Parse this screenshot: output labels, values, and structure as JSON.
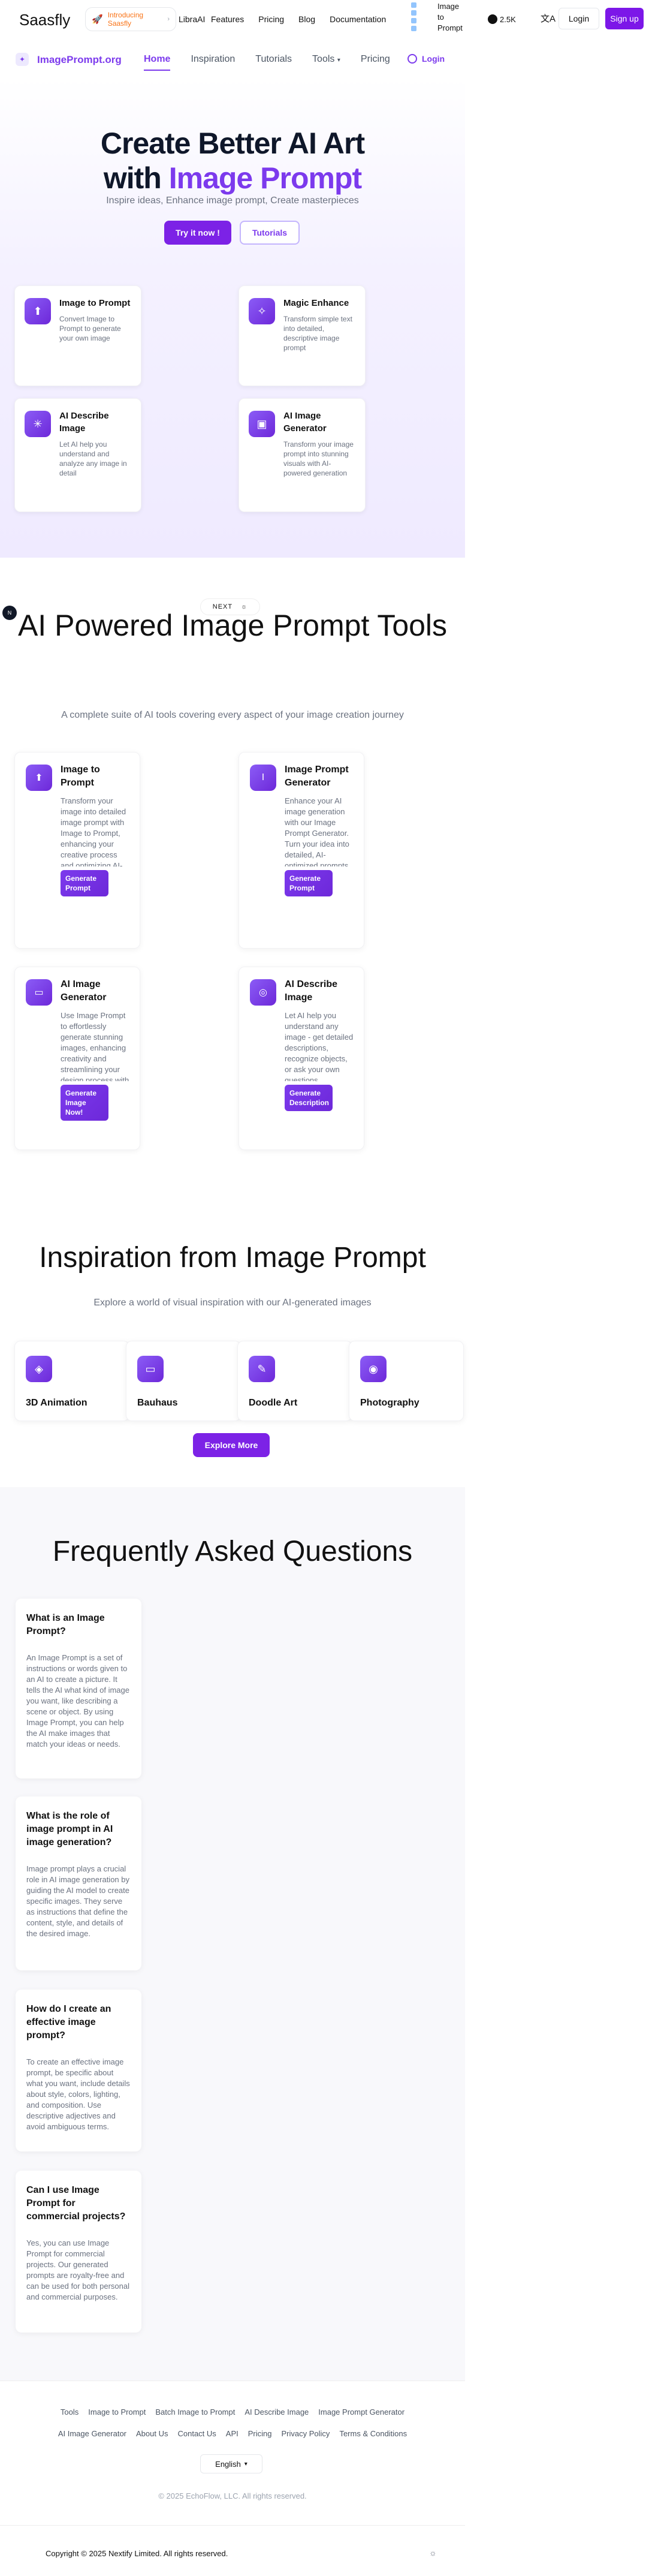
{
  "header": {
    "brand": "Saasfly",
    "intro_pill": "Introducing Saasfly",
    "libra_line1": "Libra",
    "libra_line2": "AI",
    "nav": [
      "Features",
      "Pricing",
      "Blog",
      "Documentation"
    ],
    "image_to_prompt": "Image to Prompt",
    "github_stars": "2.5K",
    "login": "Login",
    "signup": "Sign up"
  },
  "subnav": {
    "brand": "ImagePrompt.org",
    "links": [
      "Home",
      "Inspiration",
      "Tutorials",
      "Tools",
      "Pricing"
    ],
    "active": "Home",
    "login": "Login"
  },
  "hero": {
    "title_line1": "Create Better AI Art",
    "title_line2_prefix": "with",
    "title_line2_highlight": "Image Prompt",
    "subtitle": "Inspire ideas, Enhance image prompt, Create masterpieces",
    "try_button": "Try it now !",
    "tutorials_button": "Tutorials",
    "cards": [
      {
        "title": "Image to Prompt",
        "desc": "Convert Image to Prompt to generate your own image",
        "icon": "image-upload-icon"
      },
      {
        "title": "Magic Enhance",
        "desc": "Transform simple text into detailed, descriptive image prompt",
        "icon": "sparkle-icon"
      },
      {
        "title": "AI Describe Image",
        "desc": "Let AI help you understand and analyze any image in detail",
        "icon": "describe-icon"
      },
      {
        "title": "AI Image Generator",
        "desc": "Transform your image prompt into stunning visuals with AI-powered generation",
        "icon": "image-generate-icon"
      }
    ]
  },
  "side_marker": "N",
  "tools": {
    "new_label": "NEXT",
    "title": "AI Powered Image Prompt Tools",
    "subtitle": "A complete suite of AI tools covering every aspect of your image creation journey",
    "cards": [
      {
        "title": "Image to Prompt",
        "desc": "Transform your image into detailed image prompt with Image to Prompt, enhancing your creative process and optimizing AI-driven design efficiency.",
        "button": "Generate Prompt"
      },
      {
        "title": "Image Prompt Generator",
        "desc": "Enhance your AI image generation with our Image Prompt Generator. Turn your idea into detailed, AI-optimized prompts, whether you're fluent in English or not.",
        "button": "Generate Prompt"
      },
      {
        "title": "AI Image Generator",
        "desc": "Use Image Prompt to effortlessly generate stunning images, enhancing creativity and streamlining your design process with AI-powered precision.",
        "button": "Generate Image Now!"
      },
      {
        "title": "AI Describe Image",
        "desc": "Let AI help you understand any image - get detailed descriptions, recognize objects, or ask your own questions.",
        "button": "Generate Description"
      }
    ]
  },
  "inspiration": {
    "title": "Inspiration from Image Prompt",
    "subtitle": "Explore a world of visual inspiration with our AI-generated images",
    "categories": [
      {
        "title": "3D Animation",
        "icon": "cube-icon"
      },
      {
        "title": "Bauhaus",
        "icon": "monitor-icon"
      },
      {
        "title": "Doodle Art",
        "icon": "pencil-icon"
      },
      {
        "title": "Photography",
        "icon": "camera-icon"
      }
    ],
    "explore_button": "Explore More"
  },
  "faq": {
    "title": "Frequently Asked Questions",
    "items": [
      {
        "q": "What is an Image Prompt?",
        "a": "An Image Prompt is a set of instructions or words given to an AI to create a picture. It tells the AI what kind of image you want, like describing a scene or object. By using Image Prompt, you can help the AI make images that match your ideas or needs."
      },
      {
        "q": "What is the role of image prompt in AI image generation?",
        "a": "Image prompt plays a crucial role in AI image generation by guiding the AI model to create specific images. They serve as instructions that define the content, style, and details of the desired image."
      },
      {
        "q": "How do I create an effective image prompt?",
        "a": "To create an effective image prompt, be specific about what you want, include details about style, colors, lighting, and composition. Use descriptive adjectives and avoid ambiguous terms."
      },
      {
        "q": "Can I use Image Prompt for commercial projects?",
        "a": "Yes, you can use Image Prompt for commercial projects. Our generated prompts are royalty-free and can be used for both personal and commercial purposes."
      }
    ]
  },
  "footer": {
    "row1": [
      "Tools",
      "Image to Prompt",
      "Batch Image to Prompt",
      "AI Describe Image",
      "Image Prompt Generator"
    ],
    "row2": [
      "AI Image Generator",
      "About Us",
      "Contact Us",
      "API",
      "Pricing",
      "Privacy Policy",
      "Terms & Conditions"
    ],
    "language": "English",
    "copyright": "© 2025 EchoFlow, LLC. All rights reserved.",
    "bottom_copyright": "Copyright © 2025 Nextify Limited. All rights reserved."
  }
}
